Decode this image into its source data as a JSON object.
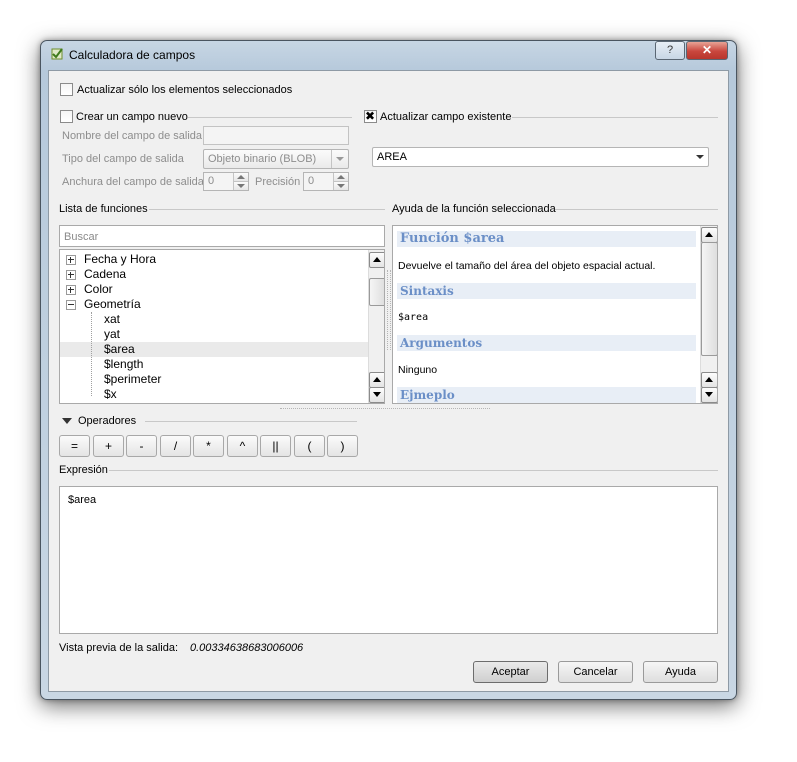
{
  "window": {
    "title": "Calculadora de campos",
    "help_symbol": "?",
    "close_symbol": "✕"
  },
  "selected_only": {
    "label": "Actualizar sólo los elementos seleccionados",
    "checked": false
  },
  "new_field": {
    "label": "Crear un campo nuevo",
    "checked": false,
    "name_label": "Nombre del campo de salida",
    "name_value": "",
    "type_label": "Tipo del campo de salida",
    "type_value": "Objeto binario (BLOB)",
    "width_label": "Anchura del campo de salida",
    "width_value": "0",
    "precision_label": "Precisión",
    "precision_value": "0"
  },
  "update_field": {
    "label": "Actualizar campo existente",
    "checked": true,
    "selected": "AREA"
  },
  "functions": {
    "title": "Lista de funciones",
    "search_placeholder": "Buscar",
    "tree": [
      {
        "label": "Fecha y Hora",
        "expandable": true,
        "expanded": false
      },
      {
        "label": "Cadena",
        "expandable": true,
        "expanded": false
      },
      {
        "label": "Color",
        "expandable": true,
        "expanded": false
      },
      {
        "label": "Geometría",
        "expandable": true,
        "expanded": true
      },
      {
        "label": "xat",
        "child": true
      },
      {
        "label": "yat",
        "child": true
      },
      {
        "label": "$area",
        "child": true,
        "selected": true
      },
      {
        "label": "$length",
        "child": true
      },
      {
        "label": "$perimeter",
        "child": true
      },
      {
        "label": "$x",
        "child": true
      }
    ]
  },
  "help": {
    "title": "Ayuda de la función seleccionada",
    "heading": "Función $area",
    "description": "Devuelve el tamaño del área del objeto espacial actual.",
    "syntax_heading": "Sintaxis",
    "syntax": "$area",
    "args_heading": "Argumentos",
    "args": "Ninguno",
    "example_heading": "Ejmeplo"
  },
  "operators": {
    "label": "Operadores",
    "buttons": [
      "=",
      "+",
      "-",
      "/",
      "*",
      "^",
      "||",
      "(",
      ")"
    ]
  },
  "expression": {
    "label": "Expresión",
    "value": "$area"
  },
  "preview": {
    "label": "Vista previa de la salida:",
    "value": "0.00334638683006006"
  },
  "buttons": {
    "ok": "Aceptar",
    "cancel": "Cancelar",
    "help": "Ayuda"
  },
  "colors": {
    "help_heading": "#6b8fc7",
    "close_button": "#c9463d"
  }
}
